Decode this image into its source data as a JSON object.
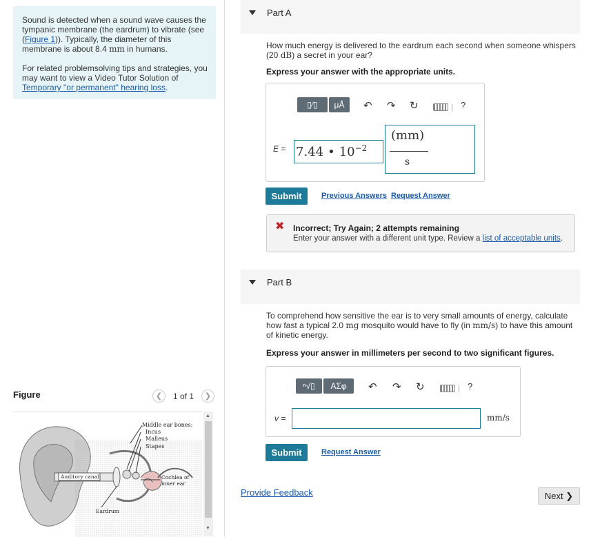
{
  "intro": {
    "p1_before_link": "Sound is detected when a sound wave causes the tympanic membrane (the eardrum) to vibrate (see (",
    "p1_link": "Figure 1",
    "p1_after_link": ")). Typically, the diameter of this membrane is about 8.4 ",
    "p1_unit": "mm",
    "p1_end": " in humans.",
    "p2_text": "For related problemsolving tips and strategies, you may want to view a Video Tutor Solution of ",
    "p2_link": "Temporary \"or permanent\" hearing loss",
    "p2_end": "."
  },
  "figure": {
    "label": "Figure",
    "pager": "1 of 1",
    "labels": {
      "middle_ear_bones": "Middle ear bones:",
      "incus": "Incus",
      "malleus": "Malleus",
      "stapes": "Stapes",
      "auditory_canal": "Auditory canal",
      "cochlea": "Cochlea of",
      "inner_ear": "inner ear",
      "eardrum": "Eardrum"
    }
  },
  "partA": {
    "title": "Part A",
    "question_before": "How much energy is delivered to the eardrum each second when someone whispers (20 ",
    "question_unit": "dB",
    "question_after": ") a secret in your ear?",
    "instruction": "Express your answer with the appropriate units.",
    "toolbar": {
      "templates": "▯⁄▯",
      "units": "μÅ",
      "help": "?"
    },
    "var_label": "E =",
    "value_mantissa": "7.44",
    "value_dot": "•",
    "value_base": "10",
    "value_exp": "−2",
    "unit_numerator": "(mm)",
    "unit_denominator": "s",
    "submit": "Submit",
    "previous_answers": "Previous Answers",
    "request_answer": "Request Answer",
    "feedback_title": "Incorrect; Try Again; 2 attempts remaining",
    "feedback_text": "Enter your answer with a different unit type. Review a ",
    "feedback_link": "list of acceptable units",
    "feedback_end": "."
  },
  "partB": {
    "title": "Part B",
    "question_before": "To comprehend how sensitive the ear is to very small amounts of energy, calculate how fast a typical 2.0 ",
    "question_mg": "mg",
    "question_mid": " mosquito would have to fly (in ",
    "question_unit": "mm/s",
    "question_after": ") to have this amount of kinetic energy.",
    "instruction": "Express your answer in millimeters per second to two significant figures.",
    "toolbar": {
      "templates": "ⁿ√▯",
      "greek": "ΑΣφ",
      "help": "?"
    },
    "var_label": "v =",
    "input_value": "",
    "unit": "mm/s",
    "submit": "Submit",
    "request_answer": "Request Answer"
  },
  "provide_feedback": "Provide Feedback",
  "next": "Next ❯",
  "colors": {
    "submit": "#1d7a99",
    "link": "#1a5aa8",
    "error": "#c0262c",
    "intro_bg": "#e6f4f7"
  }
}
